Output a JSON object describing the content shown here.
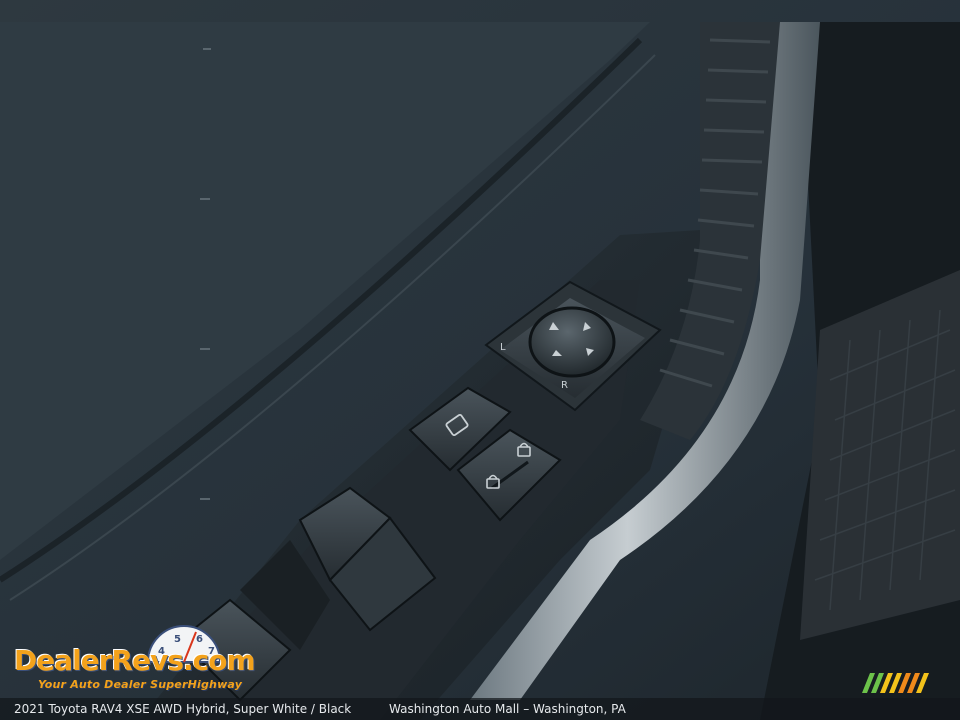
{
  "caption": {
    "vehicle": "2021 Toyota RAV4 XSE AWD Hybrid,  Super White / Black",
    "dealer": "Washington Auto Mall – Washington, PA"
  },
  "watermark": {
    "brand": "DealerRevs.com",
    "tagline": "Your Auto Dealer SuperHighway",
    "gauge_digits": [
      "4",
      "5",
      "6",
      "7"
    ]
  },
  "switch_labels": {
    "mirror_left": "L",
    "mirror_right": "R"
  },
  "colors": {
    "logo_orange": "#f3a21b",
    "logo_blue": "#3a4f7a",
    "stripe_green": "#6cc24a",
    "stripe_yellow": "#f3c21b",
    "stripe_orange": "#f08a1b"
  }
}
